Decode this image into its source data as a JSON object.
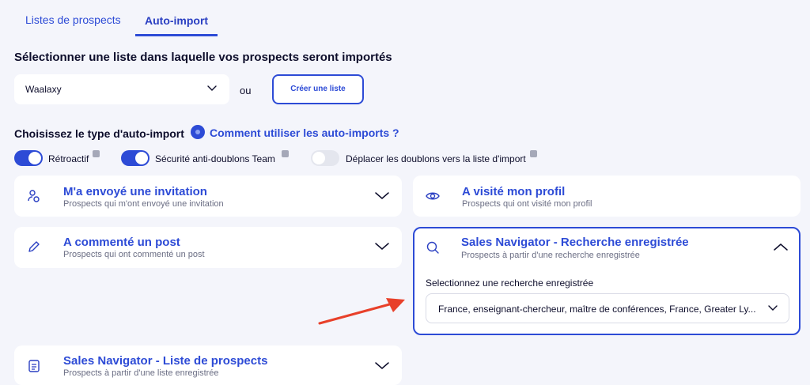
{
  "tabs": [
    {
      "label": "Listes de prospects",
      "active": false
    },
    {
      "label": "Auto-import",
      "active": true
    }
  ],
  "heading": "Sélectionner une liste dans laquelle vos prospects seront importés",
  "list_select": {
    "value": "Waalaxy"
  },
  "or_text": "ou",
  "create_button": "Créer une liste",
  "type_heading": "Choisissez le type d'auto-import",
  "help_link": "Comment utiliser les auto-imports ?",
  "toggles": [
    {
      "label": "Rétroactif",
      "on": true
    },
    {
      "label": "Sécurité anti-doublons Team",
      "on": true
    },
    {
      "label": "Déplacer les doublons vers la liste d'import",
      "on": false
    }
  ],
  "cards": [
    {
      "title": "M'a envoyé une invitation",
      "subtitle": "Prospects qui m'ont envoyé une invitation",
      "icon": "user-invite-icon",
      "expanded": false
    },
    {
      "title": "A visité mon profil",
      "subtitle": "Prospects qui ont visité mon profil",
      "icon": "eye-icon",
      "expanded": false
    },
    {
      "title": "A commenté un post",
      "subtitle": "Prospects qui ont commenté un post",
      "icon": "pencil-icon",
      "expanded": false
    },
    {
      "title": "Sales Navigator - Recherche enregistrée",
      "subtitle": "Prospects à partir d'une recherche enregistrée",
      "icon": "search-icon",
      "expanded": true
    },
    {
      "title": "Sales Navigator - Liste de prospects",
      "subtitle": "Prospects à partir d'une liste enregistrée",
      "icon": "document-icon",
      "expanded": false
    }
  ],
  "saved_search": {
    "label": "Selectionnez une recherche enregistrée",
    "value": "France, enseignant-chercheur, maître de conférences, France, Greater Ly..."
  },
  "colors": {
    "accent": "#2d4bd6",
    "background": "#f4f5fb",
    "arrow": "#e8402a"
  }
}
